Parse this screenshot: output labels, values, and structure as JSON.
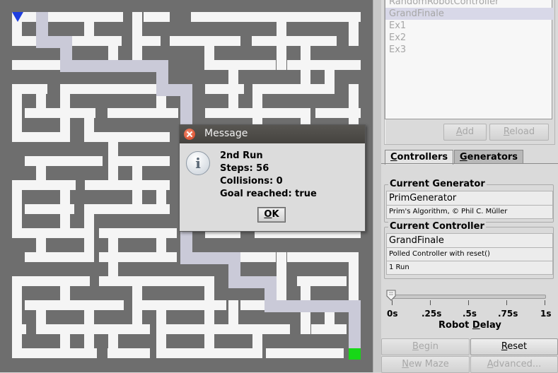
{
  "maze": {
    "start_marker": "blue-triangle",
    "goal_marker": "green-square",
    "colors": {
      "wall": "#6e6e6e",
      "floor": "#f5f5f5",
      "path": "#cacad8",
      "start": "#1f3fe0",
      "goal": "#17d817"
    }
  },
  "controller_list": {
    "items": [
      "RandomRobotController",
      "GrandFinale",
      "Ex1",
      "Ex2",
      "Ex3"
    ],
    "selected": "GrandFinale"
  },
  "buttons": {
    "add": "Add",
    "reload": "Reload",
    "begin": "Begin",
    "reset": "Reset",
    "new_maze": "New Maze",
    "advanced": "Advanced..."
  },
  "tabs": {
    "controllers": "Controllers",
    "generators": "Generators",
    "active": "Controllers"
  },
  "generator": {
    "title": "Current Generator",
    "name": "PrimGenerator",
    "description": "Prim's Algorithm, © Phil C. Müller"
  },
  "controller": {
    "title": "Current Controller",
    "name": "GrandFinale",
    "description": "Polled Controller with reset()",
    "runs": "1 Run"
  },
  "slider": {
    "tick_labels": [
      "0s",
      ".25s",
      ".5s",
      ".75s",
      "1s"
    ],
    "caption": "Robot Delay",
    "value_fraction": 0.0
  },
  "dialog": {
    "title": "Message",
    "lines": [
      "2nd Run",
      "Steps: 56",
      "Collisions: 0",
      "Goal reached: true"
    ],
    "ok": "OK"
  }
}
